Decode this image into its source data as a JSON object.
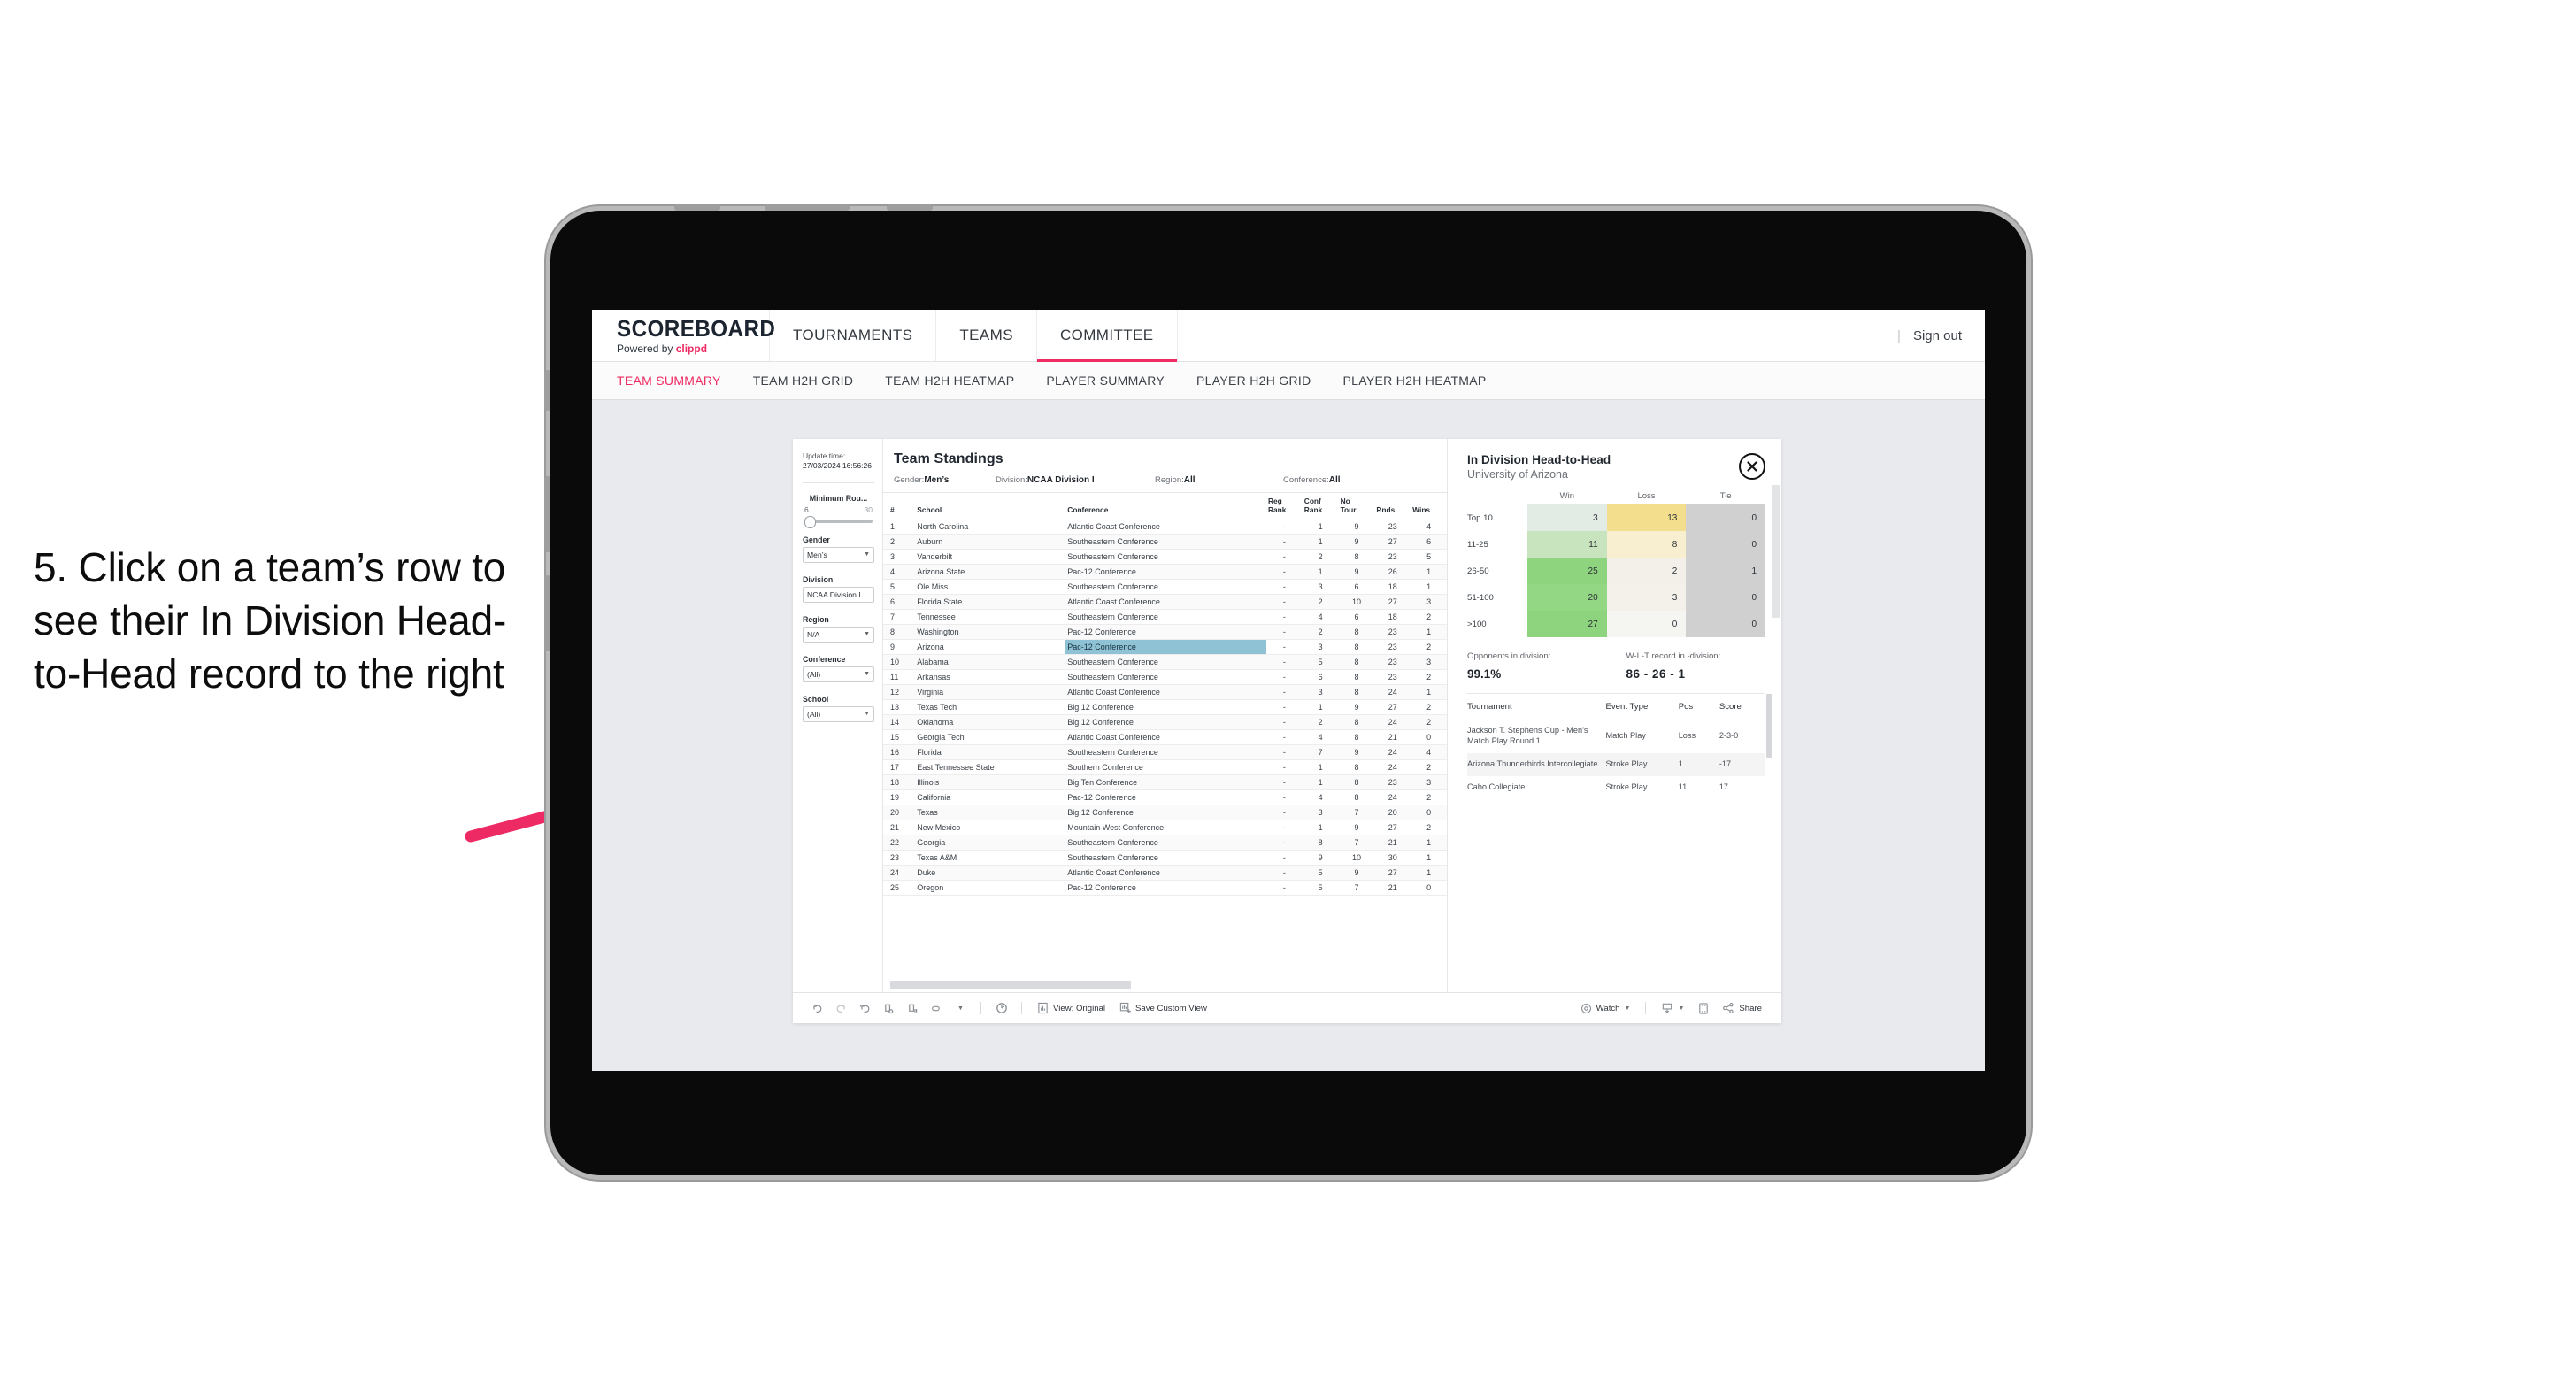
{
  "annotation": {
    "text": "5. Click on a team’s row to see their In Division Head-to-Head record to the right"
  },
  "app": {
    "brand_title": "SCOREBOARD",
    "brand_sub_prefix": "Powered by ",
    "brand_sub_accent": "clippd",
    "nav_tabs": [
      {
        "label": "TOURNAMENTS",
        "active": false
      },
      {
        "label": "TEAMS",
        "active": false
      },
      {
        "label": "COMMITTEE",
        "active": true
      }
    ],
    "sign_out": "Sign out",
    "sign_out_divider": "|",
    "sub_tabs": [
      {
        "label": "TEAM SUMMARY",
        "active": true
      },
      {
        "label": "TEAM H2H GRID",
        "active": false
      },
      {
        "label": "TEAM H2H HEATMAP",
        "active": false
      },
      {
        "label": "PLAYER SUMMARY",
        "active": false
      },
      {
        "label": "PLAYER H2H GRID",
        "active": false
      },
      {
        "label": "PLAYER H2H HEATMAP",
        "active": false
      }
    ],
    "accent_color": "#ef2b63"
  },
  "sidebar": {
    "update_label": "Update time:",
    "update_value": "27/03/2024 16:56:26",
    "min_rounds": {
      "title": "Minimum Rou...",
      "min": "6",
      "max": "30"
    },
    "filters": [
      {
        "title": "Gender",
        "value": "Men’s"
      },
      {
        "title": "Division",
        "value": "NCAA Division I"
      },
      {
        "title": "Region",
        "value": "N/A"
      },
      {
        "title": "Conference",
        "value": "(All)"
      },
      {
        "title": "School",
        "value": "(All)"
      }
    ]
  },
  "standings": {
    "title": "Team Standings",
    "meta": [
      {
        "label": "Gender: ",
        "value": "Men’s"
      },
      {
        "label": "Division: ",
        "value": "NCAA Division I"
      },
      {
        "label": "Region: ",
        "value": "All"
      },
      {
        "label": "Conference: ",
        "value": "All"
      }
    ],
    "columns": [
      "#",
      "School",
      "Conference",
      "Reg Rank",
      "Conf Rank",
      "No Tour",
      "Rnds",
      "Wins"
    ],
    "selected_row_index": 8,
    "rows": [
      {
        "rank": "1",
        "school": "North Carolina",
        "conference": "Atlantic Coast Conference",
        "reg_rank": "-",
        "conf_rank": "1",
        "no_tour": "9",
        "rnds": "23",
        "wins": "4"
      },
      {
        "rank": "2",
        "school": "Auburn",
        "conference": "Southeastern Conference",
        "reg_rank": "-",
        "conf_rank": "1",
        "no_tour": "9",
        "rnds": "27",
        "wins": "6"
      },
      {
        "rank": "3",
        "school": "Vanderbilt",
        "conference": "Southeastern Conference",
        "reg_rank": "-",
        "conf_rank": "2",
        "no_tour": "8",
        "rnds": "23",
        "wins": "5"
      },
      {
        "rank": "4",
        "school": "Arizona State",
        "conference": "Pac-12 Conference",
        "reg_rank": "-",
        "conf_rank": "1",
        "no_tour": "9",
        "rnds": "26",
        "wins": "1"
      },
      {
        "rank": "5",
        "school": "Ole Miss",
        "conference": "Southeastern Conference",
        "reg_rank": "-",
        "conf_rank": "3",
        "no_tour": "6",
        "rnds": "18",
        "wins": "1"
      },
      {
        "rank": "6",
        "school": "Florida State",
        "conference": "Atlantic Coast Conference",
        "reg_rank": "-",
        "conf_rank": "2",
        "no_tour": "10",
        "rnds": "27",
        "wins": "3"
      },
      {
        "rank": "7",
        "school": "Tennessee",
        "conference": "Southeastern Conference",
        "reg_rank": "-",
        "conf_rank": "4",
        "no_tour": "6",
        "rnds": "18",
        "wins": "2"
      },
      {
        "rank": "8",
        "school": "Washington",
        "conference": "Pac-12 Conference",
        "reg_rank": "-",
        "conf_rank": "2",
        "no_tour": "8",
        "rnds": "23",
        "wins": "1"
      },
      {
        "rank": "9",
        "school": "Arizona",
        "conference": "Pac-12 Conference",
        "reg_rank": "-",
        "conf_rank": "3",
        "no_tour": "8",
        "rnds": "23",
        "wins": "2"
      },
      {
        "rank": "10",
        "school": "Alabama",
        "conference": "Southeastern Conference",
        "reg_rank": "-",
        "conf_rank": "5",
        "no_tour": "8",
        "rnds": "23",
        "wins": "3"
      },
      {
        "rank": "11",
        "school": "Arkansas",
        "conference": "Southeastern Conference",
        "reg_rank": "-",
        "conf_rank": "6",
        "no_tour": "8",
        "rnds": "23",
        "wins": "2"
      },
      {
        "rank": "12",
        "school": "Virginia",
        "conference": "Atlantic Coast Conference",
        "reg_rank": "-",
        "conf_rank": "3",
        "no_tour": "8",
        "rnds": "24",
        "wins": "1"
      },
      {
        "rank": "13",
        "school": "Texas Tech",
        "conference": "Big 12 Conference",
        "reg_rank": "-",
        "conf_rank": "1",
        "no_tour": "9",
        "rnds": "27",
        "wins": "2"
      },
      {
        "rank": "14",
        "school": "Oklahoma",
        "conference": "Big 12 Conference",
        "reg_rank": "-",
        "conf_rank": "2",
        "no_tour": "8",
        "rnds": "24",
        "wins": "2"
      },
      {
        "rank": "15",
        "school": "Georgia Tech",
        "conference": "Atlantic Coast Conference",
        "reg_rank": "-",
        "conf_rank": "4",
        "no_tour": "8",
        "rnds": "21",
        "wins": "0"
      },
      {
        "rank": "16",
        "school": "Florida",
        "conference": "Southeastern Conference",
        "reg_rank": "-",
        "conf_rank": "7",
        "no_tour": "9",
        "rnds": "24",
        "wins": "4"
      },
      {
        "rank": "17",
        "school": "East Tennessee State",
        "conference": "Southern Conference",
        "reg_rank": "-",
        "conf_rank": "1",
        "no_tour": "8",
        "rnds": "24",
        "wins": "2"
      },
      {
        "rank": "18",
        "school": "Illinois",
        "conference": "Big Ten Conference",
        "reg_rank": "-",
        "conf_rank": "1",
        "no_tour": "8",
        "rnds": "23",
        "wins": "3"
      },
      {
        "rank": "19",
        "school": "California",
        "conference": "Pac-12 Conference",
        "reg_rank": "-",
        "conf_rank": "4",
        "no_tour": "8",
        "rnds": "24",
        "wins": "2"
      },
      {
        "rank": "20",
        "school": "Texas",
        "conference": "Big 12 Conference",
        "reg_rank": "-",
        "conf_rank": "3",
        "no_tour": "7",
        "rnds": "20",
        "wins": "0"
      },
      {
        "rank": "21",
        "school": "New Mexico",
        "conference": "Mountain West Conference",
        "reg_rank": "-",
        "conf_rank": "1",
        "no_tour": "9",
        "rnds": "27",
        "wins": "2"
      },
      {
        "rank": "22",
        "school": "Georgia",
        "conference": "Southeastern Conference",
        "reg_rank": "-",
        "conf_rank": "8",
        "no_tour": "7",
        "rnds": "21",
        "wins": "1"
      },
      {
        "rank": "23",
        "school": "Texas A&M",
        "conference": "Southeastern Conference",
        "reg_rank": "-",
        "conf_rank": "9",
        "no_tour": "10",
        "rnds": "30",
        "wins": "1"
      },
      {
        "rank": "24",
        "school": "Duke",
        "conference": "Atlantic Coast Conference",
        "reg_rank": "-",
        "conf_rank": "5",
        "no_tour": "9",
        "rnds": "27",
        "wins": "1"
      },
      {
        "rank": "25",
        "school": "Oregon",
        "conference": "Pac-12 Conference",
        "reg_rank": "-",
        "conf_rank": "5",
        "no_tour": "7",
        "rnds": "21",
        "wins": "0"
      }
    ]
  },
  "detail": {
    "title": "In Division Head-to-Head",
    "subtitle": "University of Arizona",
    "close_icon": "close-icon",
    "chart_data": {
      "type": "heatmap",
      "title": "In Division Head-to-Head",
      "subtitle": "University of Arizona",
      "columns": [
        "Win",
        "Loss",
        "Tie"
      ],
      "rows": [
        "Top 10",
        "11-25",
        "26-50",
        "51-100",
        ">100"
      ],
      "values": [
        [
          3,
          13,
          0
        ],
        [
          11,
          8,
          0
        ],
        [
          25,
          2,
          1
        ],
        [
          20,
          3,
          0
        ],
        [
          27,
          0,
          0
        ]
      ],
      "cell_colors": [
        [
          "#e3ece4",
          "#f2de8d",
          "#d0d0d0"
        ],
        [
          "#c8e4bf",
          "#f7efd0",
          "#d0d0d0"
        ],
        [
          "#8ed47e",
          "#f2f0e9",
          "#d0d0d0"
        ],
        [
          "#93d684",
          "#f3f1ea",
          "#d0d0d0"
        ],
        [
          "#8ed47e",
          "#f5f5f2",
          "#d0d0d0"
        ]
      ],
      "legend": "none",
      "grid": false
    },
    "stats": [
      {
        "label": "Opponents in division:",
        "value": "99.1%"
      },
      {
        "label": "W-L-T record in -division:",
        "value": "86 - 26 - 1"
      }
    ],
    "tour_columns": [
      "Tournament",
      "Event Type",
      "Pos",
      "Score"
    ],
    "tours": [
      {
        "name": "Jackson T. Stephens Cup - Men’s Match Play Round 1",
        "type": "Match Play",
        "pos": "Loss",
        "score": "2-3-0"
      },
      {
        "name": "Arizona Thunderbirds Intercollegiate",
        "type": "Stroke Play",
        "pos": "1",
        "score": "-17"
      },
      {
        "name": "Cabo Collegiate",
        "type": "Stroke Play",
        "pos": "11",
        "score": "17"
      }
    ]
  },
  "toolbar": {
    "icons": [
      "undo-icon",
      "redo-icon",
      "revert-icon",
      "refresh-data-icon",
      "pause-updates-icon",
      "view-shape-icon"
    ],
    "slideshow_icon": "slideshow-icon",
    "view_label": "View: Original",
    "view_icon": "view-original-icon",
    "save_label": "Save Custom View",
    "save_icon": "save-view-icon",
    "watch_label": "Watch",
    "watch_icon": "watch-icon",
    "download_icon": "download-icon",
    "fullscreen_icon": "fullscreen-icon",
    "share_label": "Share",
    "share_icon": "share-icon"
  }
}
